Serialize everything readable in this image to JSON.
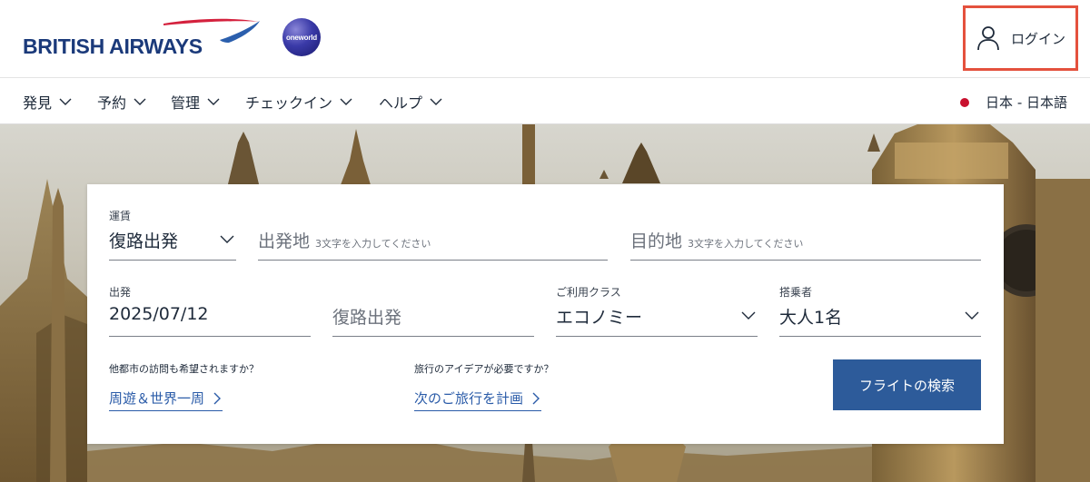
{
  "brand": {
    "logo_text": "BRITISH AIRWAYS",
    "alliance": "oneworld",
    "colors": {
      "navy": "#1b3a7a",
      "swoosh_red": "#d4213d",
      "swoosh_blue": "#2b5fad",
      "button_blue": "#2d5b9a",
      "link_blue": "#2a5ba8",
      "highlight": "#e4513d"
    }
  },
  "header": {
    "login": {
      "icon": "user-icon",
      "label": "ログイン"
    }
  },
  "nav": {
    "items": [
      {
        "label": "発見",
        "icon": "chevron-down-icon"
      },
      {
        "label": "予約",
        "icon": "chevron-down-icon"
      },
      {
        "label": "管理",
        "icon": "chevron-down-icon"
      },
      {
        "label": "チェックイン",
        "icon": "chevron-down-icon"
      },
      {
        "label": "ヘルプ",
        "icon": "chevron-down-icon"
      }
    ],
    "locale": "日本 - 日本語"
  },
  "search": {
    "fare": {
      "label": "運賃",
      "value": "復路出発"
    },
    "origin": {
      "placeholder": "出発地",
      "hint": "3文字を入力してください"
    },
    "destination": {
      "placeholder": "目的地",
      "hint": "3文字を入力してください"
    },
    "depart": {
      "label": "出発",
      "value": "2025/07/12"
    },
    "return": {
      "placeholder": "復路出発"
    },
    "cabin": {
      "label": "ご利用クラス",
      "value": "エコノミー"
    },
    "passengers": {
      "label": "搭乗者",
      "value": "大人1名"
    },
    "multicity": {
      "question": "他都市の訪問も希望されますか？",
      "link": "周遊＆世界一周"
    },
    "ideas": {
      "question": "旅行のアイデアが必要ですか？",
      "link": "次のご旅行を計画"
    },
    "submit": "フライトの検索"
  }
}
